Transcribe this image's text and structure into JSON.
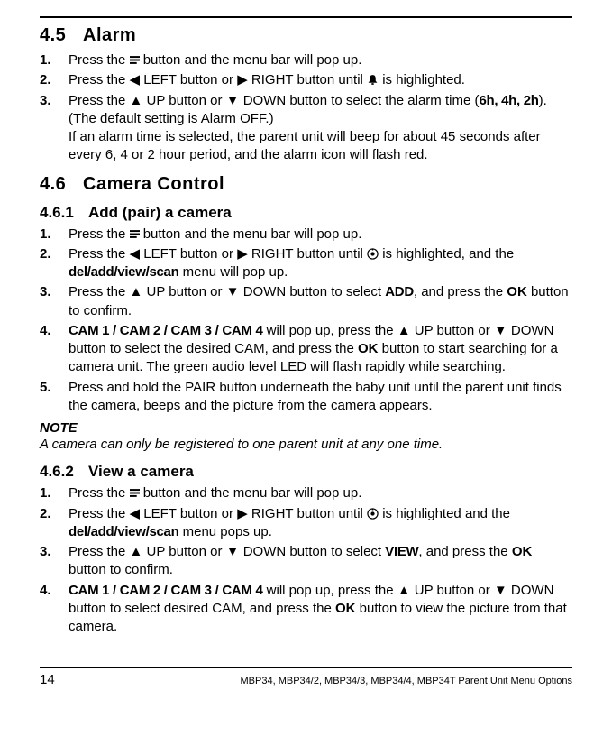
{
  "section45": {
    "num": "4.5",
    "title": "Alarm",
    "steps": [
      {
        "pre": "Press the ",
        "icon": "menu",
        "post": " button and the menu bar will pop up."
      },
      {
        "t1": "Press the ",
        "i1": "◀",
        "t2": " LEFT button or ",
        "i2": "▶",
        "t3": " RIGHT button until ",
        "icon": "bell",
        "t4": " is highlighted."
      },
      {
        "t1": "Press the ",
        "i1": "▲",
        "t2": " UP button or ",
        "i2": "▼",
        "t3": " DOWN button to select the alarm time (",
        "cond": "6h, 4h, 2h",
        "t4": "). (The default setting is Alarm OFF.)",
        "tail": "If an alarm time is selected, the parent unit will beep for about 45 seconds after every 6, 4 or 2 hour period, and the alarm icon will flash red."
      }
    ]
  },
  "section46": {
    "num": "4.6",
    "title": "Camera Control",
    "sub461": {
      "num": "4.6.1",
      "title": "Add (pair) a camera",
      "steps": [
        {
          "pre": "Press the ",
          "icon": "menu",
          "post": " button and the menu bar will pop up."
        },
        {
          "t1": "Press the ",
          "i1": "◀",
          "t2": " LEFT button or ",
          "i2": "▶",
          "t3": " RIGHT button until ",
          "icon": "cam",
          "t4": " is highlighted, and the ",
          "cond": "del/add/view/scan",
          "t5": " menu will pop up."
        },
        {
          "t1": "Press the ",
          "i1": "▲",
          "t2": " UP button or ",
          "i2": "▼",
          "t3": " DOWN button to select ",
          "cond": "ADD",
          "t4": ", and press the ",
          "bold": "OK",
          "t5": " button to confirm."
        },
        {
          "cond": "CAM 1 / CAM 2 / CAM 3 / CAM 4",
          "t1": " will pop up, press the ",
          "i1": "▲",
          "t2": " UP button or ",
          "i2": "▼",
          "t3": " DOWN button to select the desired CAM, and press the ",
          "bold": "OK",
          "t4": " button to start searching for a camera unit. The green audio level LED will flash rapidly while searching."
        },
        {
          "plain": "Press and hold the PAIR button underneath the baby unit until the parent unit finds the camera, beeps and the picture from the camera appears."
        }
      ],
      "note_h": "NOTE",
      "note_b": "A camera can only be registered to one parent unit at any one time."
    },
    "sub462": {
      "num": "4.6.2",
      "title": "View a camera",
      "steps": [
        {
          "pre": "Press the ",
          "icon": "menu",
          "post": " button and the menu bar will pop up."
        },
        {
          "t1": "Press the ",
          "i1": "◀",
          "t2": " LEFT button or ",
          "i2": "▶",
          "t3": " RIGHT button until ",
          "icon": "cam",
          "t4": " is highlighted and the ",
          "cond": "del/add/view/scan",
          "t5": " menu pops up."
        },
        {
          "t1": "Press the ",
          "i1": "▲",
          "t2": " UP button or ",
          "i2": "▼",
          "t3": " DOWN button to select ",
          "cond": "VIEW",
          "t4": ", and press the ",
          "bold": "OK",
          "t5": " button to confirm."
        },
        {
          "cond": "CAM 1 / CAM 2 / CAM 3 / CAM 4",
          "t1": " will pop up, press the ",
          "i1": "▲",
          "t2": " UP button or ",
          "i2": "▼",
          "t3": " DOWN button to select desired CAM, and press the ",
          "bold": "OK",
          "t4": " button to view the picture from that camera."
        }
      ]
    }
  },
  "footer": {
    "page": "14",
    "info": "MBP34, MBP34/2, MBP34/3, MBP34/4, MBP34T Parent Unit Menu Options"
  }
}
